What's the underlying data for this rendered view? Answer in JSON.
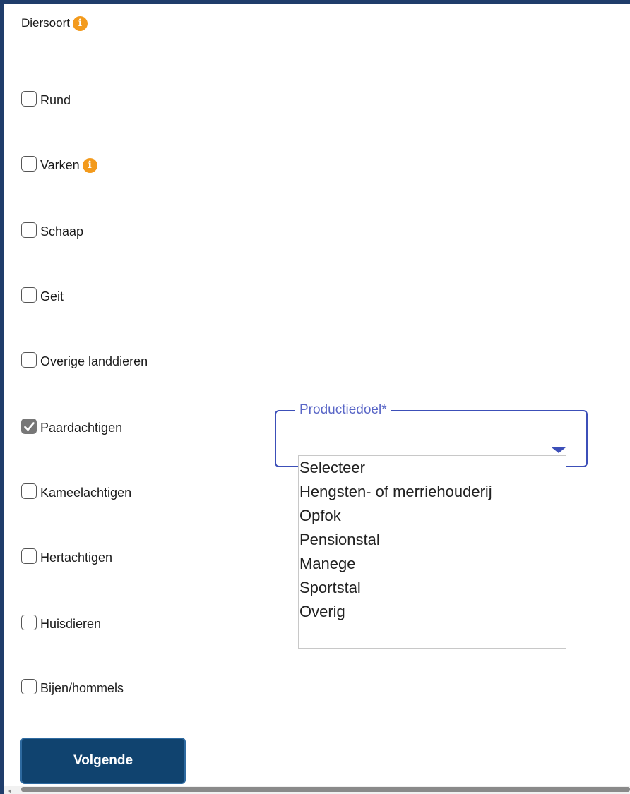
{
  "form": {
    "heading": "Diersoort",
    "heading_info_icon": "info-icon",
    "options": [
      {
        "label": "Rund",
        "checked": false,
        "info": false
      },
      {
        "label": "Varken",
        "checked": false,
        "info": true
      },
      {
        "label": "Schaap",
        "checked": false,
        "info": false
      },
      {
        "label": "Geit",
        "checked": false,
        "info": false
      },
      {
        "label": "Overige landdieren",
        "checked": false,
        "info": false
      },
      {
        "label": "Paardachtigen",
        "checked": true,
        "info": false
      },
      {
        "label": "Kameelachtigen",
        "checked": false,
        "info": false
      },
      {
        "label": "Hertachtigen",
        "checked": false,
        "info": false
      },
      {
        "label": "Huisdieren",
        "checked": false,
        "info": false
      },
      {
        "label": "Bijen/hommels",
        "checked": false,
        "info": false
      }
    ],
    "next_button": "Volgende"
  },
  "productiedoel": {
    "legend": "Productiedoel*",
    "options": [
      "Selecteer",
      "Hengsten- of merriehouderij",
      "Opfok",
      "Pensionstal",
      "Manege",
      "Sportstal",
      "Overig"
    ]
  },
  "colors": {
    "frame": "#1f3d6b",
    "info_icon": "#f39a1c",
    "select_accent": "#3c4fb8",
    "button_bg": "#10436f"
  }
}
